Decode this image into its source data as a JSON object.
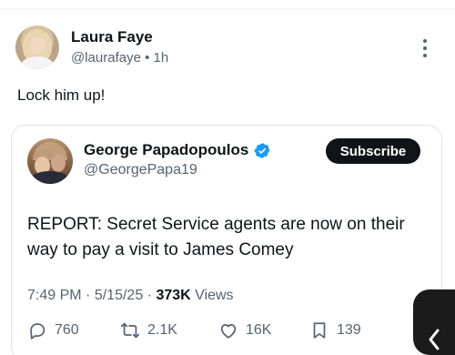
{
  "post": {
    "author_name": "Laura Faye",
    "author_handle": "@laurafaye",
    "separator": "•",
    "time_ago": "1h",
    "text": "Lock him up!"
  },
  "quoted": {
    "author_name": "George Papadopoulos",
    "author_handle": "@GeorgePapa19",
    "subscribe_label": "Subscribe",
    "text": "REPORT: Secret Service agents are now on their way to pay a visit to James Comey",
    "time": "7:49 PM",
    "dot1": "·",
    "date": "5/15/25",
    "dot2": "·",
    "views_count": "373K",
    "views_label": "Views",
    "replies": "760",
    "reposts": "2.1K",
    "likes": "16K",
    "bookmarks": "139"
  },
  "colors": {
    "verified": "#1d9bf0",
    "muted": "#536471",
    "text": "#0f1419"
  }
}
